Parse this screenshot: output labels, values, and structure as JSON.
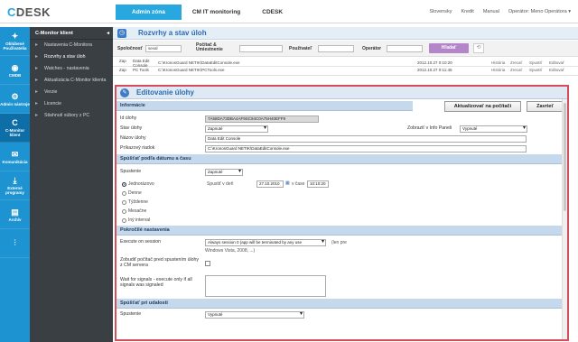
{
  "app": {
    "logo_c": "C",
    "logo_rest": "DESK"
  },
  "topnav": {
    "admin": "Admin zóna",
    "cmit": "CM IT monitoring",
    "cdesk": "CDESK"
  },
  "topright": {
    "lang": "Slovensky",
    "credit": "Kredit",
    "manual": "Manual",
    "operator": "Operátor: Meno Operátora ▾"
  },
  "iconbar": [
    {
      "icon": "✦",
      "label": "Oblúbené Použivatelia"
    },
    {
      "icon": "◉",
      "label": "CMDB"
    },
    {
      "icon": "⚙",
      "label": "Admin nástroje"
    },
    {
      "icon": "C",
      "label": "C-Monitor klient"
    },
    {
      "icon": "✉",
      "label": "Komunikácia"
    },
    {
      "icon": "⤓",
      "label": "Externé programy"
    },
    {
      "icon": "▤",
      "label": "Archív"
    },
    {
      "icon": "⫶",
      "label": ""
    }
  ],
  "menubar": {
    "title": "C-Monitor klient",
    "collapse": "◂",
    "items": [
      {
        "label": "Nastavenia C-Monitora",
        "icon": "▸"
      },
      {
        "label": "Rozvrhy a stav úloh",
        "icon": "▸"
      },
      {
        "label": "Watches - nastavenia",
        "icon": "▸"
      },
      {
        "label": "Aktualizácia C-Monitor klienta",
        "icon": "▸"
      },
      {
        "label": "Verzie",
        "icon": "▸"
      },
      {
        "label": "Licencie",
        "icon": "▸"
      },
      {
        "label": "Stiahnutí súbory z PC",
        "icon": "▸"
      }
    ]
  },
  "content": {
    "title": "Rozvrhy a stav úloh",
    "filters": {
      "company_label": "Spoločnosť",
      "company_value": "seval",
      "pc_label": "Počítač & Umiestnenie",
      "user_label": "Používateľ",
      "operator_label": "Operátor",
      "filter_btn": "Hľadať"
    },
    "rows": [
      {
        "a": "Zap",
        "b": "Data Edit Console",
        "c": "C:\\KronosGuard NETIK\\DataEditConsole.exe",
        "d": "2012.10.27 0:10:20",
        "links": [
          "História",
          "Zrecať",
          "Spustiť",
          "Editovať"
        ]
      },
      {
        "a": "Zap",
        "b": "PC Tools",
        "c": "C:\\KronosGuard NETIK\\PCTools.exe",
        "d": "2012.10.27 0:11:45",
        "links": [
          "História",
          "Zrecať",
          "Spustiť",
          "Editovať"
        ]
      }
    ]
  },
  "modal": {
    "title": "Editovanie úlohy",
    "sec_info": "Informácie",
    "btn_update": "Aktualizovať na počítači",
    "btn_close": "Zavrieť",
    "id_label": "Id úlohy",
    "id_value": "7A58DA73DBA4AF9SC94C0A75H40EFF9",
    "state_label": "Stav úlohy",
    "state_value": "Zapnuté",
    "panel_label": "Zobraziť v Info Paneli",
    "panel_value": "Vypnuté",
    "name_label": "Názov úlohy",
    "name_value": "Data Edit Console",
    "cmd_label": "Príkazový riadok",
    "cmd_value": "C:\\KronosGuard NETIK\\DataEditConsole.exe",
    "sec_start": "Spúšťať podľa dátumu a času",
    "launch_label": "Spustenie",
    "launch_value": "Zapnuté",
    "radios": [
      "Jednorázovo",
      "Denne",
      "Týždenne",
      "Mesačne",
      "Iný interval"
    ],
    "run_day_label": "Spustiť v deň",
    "run_date": "27.10.2010",
    "time_label": "v čase",
    "run_time": "10:10:20",
    "sec_adv": "Pokročilé nastavenia",
    "exec_label": "Execute on session",
    "exec_value": "Always session 0 (app will be terminated by any use",
    "exec_note_1": "(len pre",
    "exec_note_2": "Windows Vista, 2008, ...)",
    "wake_label": "Zobudiť počítač pred spustením úlohy z CM servera",
    "wait_label": "Wait for signals - execute only if all signals was signaled",
    "sec_event": "Spúšťať pri udalosti",
    "event_label": "Spustenie",
    "event_value": "Vypnuté"
  }
}
